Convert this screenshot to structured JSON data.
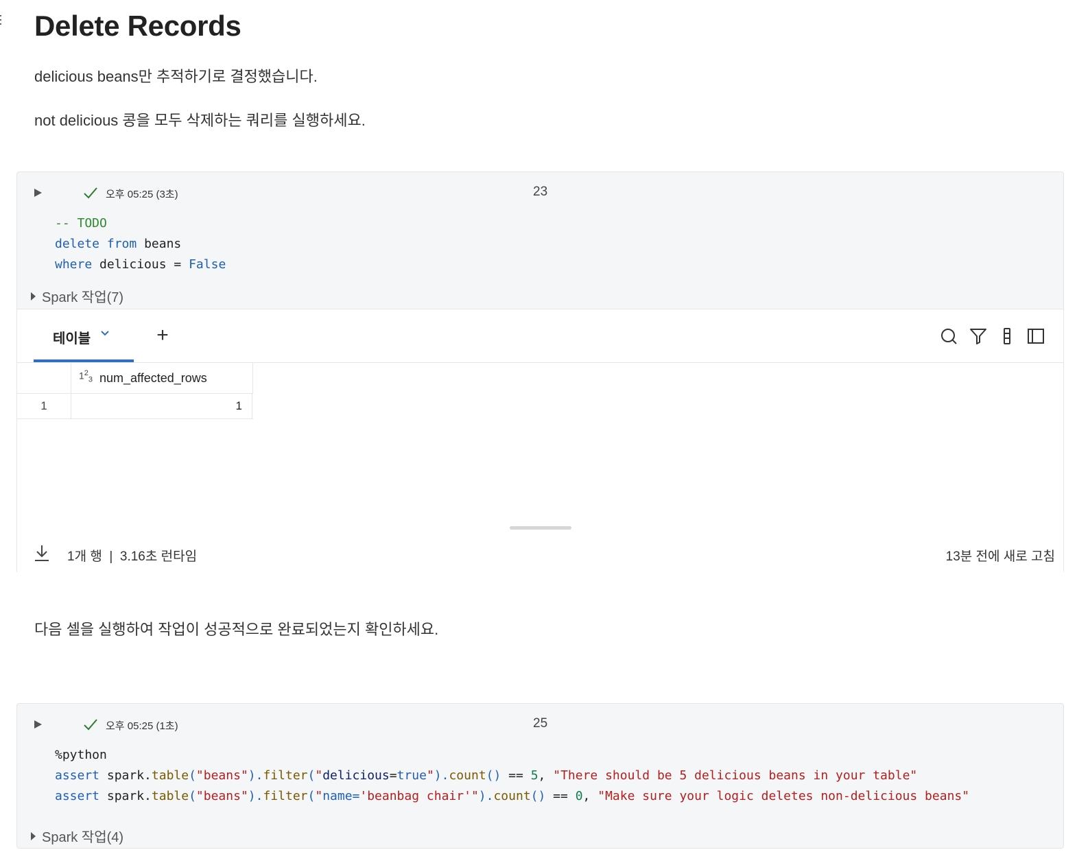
{
  "heading": "Delete Records",
  "paragraphs": [
    "delicious beans만 추적하기로 결정했습니다.",
    "not delicious 콩을 모두 삭제하는 쿼리를 실행하세요."
  ],
  "cell1": {
    "run_time": "오후 05:25 (3초)",
    "cell_number": "23",
    "code_lines": {
      "l1_comment": "-- TODO",
      "l2_kw1": "delete",
      "l2_kw2": "from",
      "l2_rest": "beans",
      "l3_kw": "where",
      "l3_mid": "delicious =",
      "l3_val": "False"
    },
    "spark_jobs": "Spark 작업(7)",
    "results": {
      "tab_label": "테이블",
      "add_tab": "+",
      "columns": [
        {
          "type_icon": "123",
          "name": "num_affected_rows"
        }
      ],
      "rows": [
        {
          "index": "1",
          "values": [
            "1"
          ]
        }
      ],
      "footer_rows": "1개 행",
      "footer_sep": "|",
      "footer_runtime": "3.16초 런타임",
      "footer_refresh": "13분 전에 새로 고침"
    },
    "icons": [
      "play-icon",
      "check-icon",
      "chevron-down-icon",
      "search-icon",
      "filter-icon",
      "column-settings-icon",
      "sidebar-panel-icon",
      "download-icon"
    ]
  },
  "middle_text": "다음 셀을 실행하여 작업이 성공적으로 완료되었는지 확인하세요.",
  "cell2": {
    "run_time": "오후 05:25 (1초)",
    "cell_number": "25",
    "line1": "%python",
    "line2": {
      "kw": "assert",
      "p1": " spark.",
      "m1": "table",
      "p2": "(",
      "s1": "\"beans\"",
      "p3": ").",
      "m2": "filter",
      "p4": "(",
      "s2a": "\"",
      "s2b": "delicious",
      "s2c": "=",
      "s2d": "true",
      "s2e": "\"",
      "p5": ").",
      "m3": "count",
      "p6": "()",
      "op": " == ",
      "n": "5",
      "p7": ", ",
      "msg": "\"There should be 5 delicious beans in your table\""
    },
    "line3": {
      "kw": "assert",
      "p1": " spark.",
      "m1": "table",
      "p2": "(",
      "s1": "\"beans\"",
      "p3": ").",
      "m2": "filter",
      "p4": "(",
      "s2a": "\"",
      "s2b": "name=",
      "s2c": "'beanbag chair'",
      "s2d": "\"",
      "p5": ").",
      "m3": "count",
      "p6": "()",
      "op": " == ",
      "n": "0",
      "p7": ", ",
      "msg": "\"Make sure your logic deletes non-delicious beans\""
    },
    "spark_jobs": "Spark 작업(4)"
  }
}
